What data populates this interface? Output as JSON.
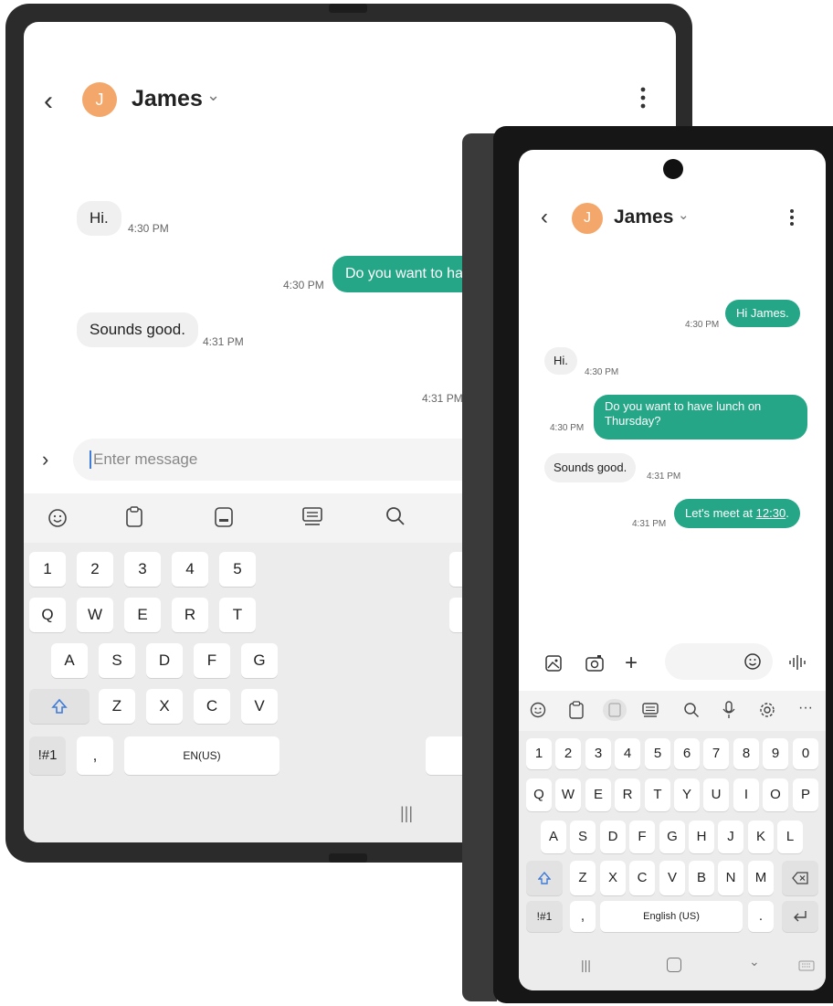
{
  "big": {
    "header": {
      "avatar_letter": "J",
      "contact_name": "James",
      "chevron": "⌄"
    },
    "messages": [
      {
        "text": "Hi.",
        "time": "4:30 PM"
      },
      {
        "text": "Do you want to ha",
        "time": "4:30 PM"
      },
      {
        "text": "Sounds good.",
        "time": "4:31 PM"
      },
      {
        "time": "4:31 PM"
      }
    ],
    "input": {
      "placeholder": "Enter message"
    },
    "toolbar": [
      "emoji-icon",
      "clipboard-icon",
      "keyboard-mode-icon",
      "keyboard-layout-icon",
      "search-icon"
    ],
    "keys": {
      "numbers": [
        "1",
        "2",
        "3",
        "4",
        "5"
      ],
      "row1": [
        "Q",
        "W",
        "E",
        "R",
        "T"
      ],
      "row2": [
        "A",
        "S",
        "D",
        "F",
        "G"
      ],
      "row3": [
        "Z",
        "X",
        "C",
        "V"
      ],
      "symbols": "!#1",
      "comma": ",",
      "space": "EN(US)"
    }
  },
  "small": {
    "header": {
      "avatar_letter": "J",
      "contact_name": "James",
      "chevron": "⌄"
    },
    "messages": [
      {
        "text": "Hi James.",
        "time": "4:30 PM"
      },
      {
        "text": "Hi.",
        "time": "4:30 PM"
      },
      {
        "line1": "Do you want to have lunch on",
        "line2": "Thursday?",
        "time": "4:30 PM"
      },
      {
        "text": "Sounds good.",
        "time": "4:31 PM"
      },
      {
        "prefix": "Let's meet at ",
        "link": "12:30",
        "suffix": ".",
        "time": "4:31 PM"
      }
    ],
    "attach": [
      "gallery-icon",
      "camera-icon",
      "plus-icon",
      "emoji-icon",
      "voice-input-icon"
    ],
    "toolbar": [
      "emoji-icon",
      "clipboard-icon",
      "keyboard-mode-icon",
      "keyboard-layout-icon",
      "search-icon",
      "microphone-icon",
      "settings-icon",
      "more-icon"
    ],
    "keys": {
      "numbers": [
        "1",
        "2",
        "3",
        "4",
        "5",
        "6",
        "7",
        "8",
        "9",
        "0"
      ],
      "row1": [
        "Q",
        "W",
        "E",
        "R",
        "T",
        "Y",
        "U",
        "I",
        "O",
        "P"
      ],
      "row2": [
        "A",
        "S",
        "D",
        "F",
        "G",
        "H",
        "J",
        "K",
        "L"
      ],
      "row3": [
        "Z",
        "X",
        "C",
        "V",
        "B",
        "N",
        "M"
      ],
      "symbols": "!#1",
      "comma": ",",
      "space": "English (US)",
      "period": "."
    }
  }
}
